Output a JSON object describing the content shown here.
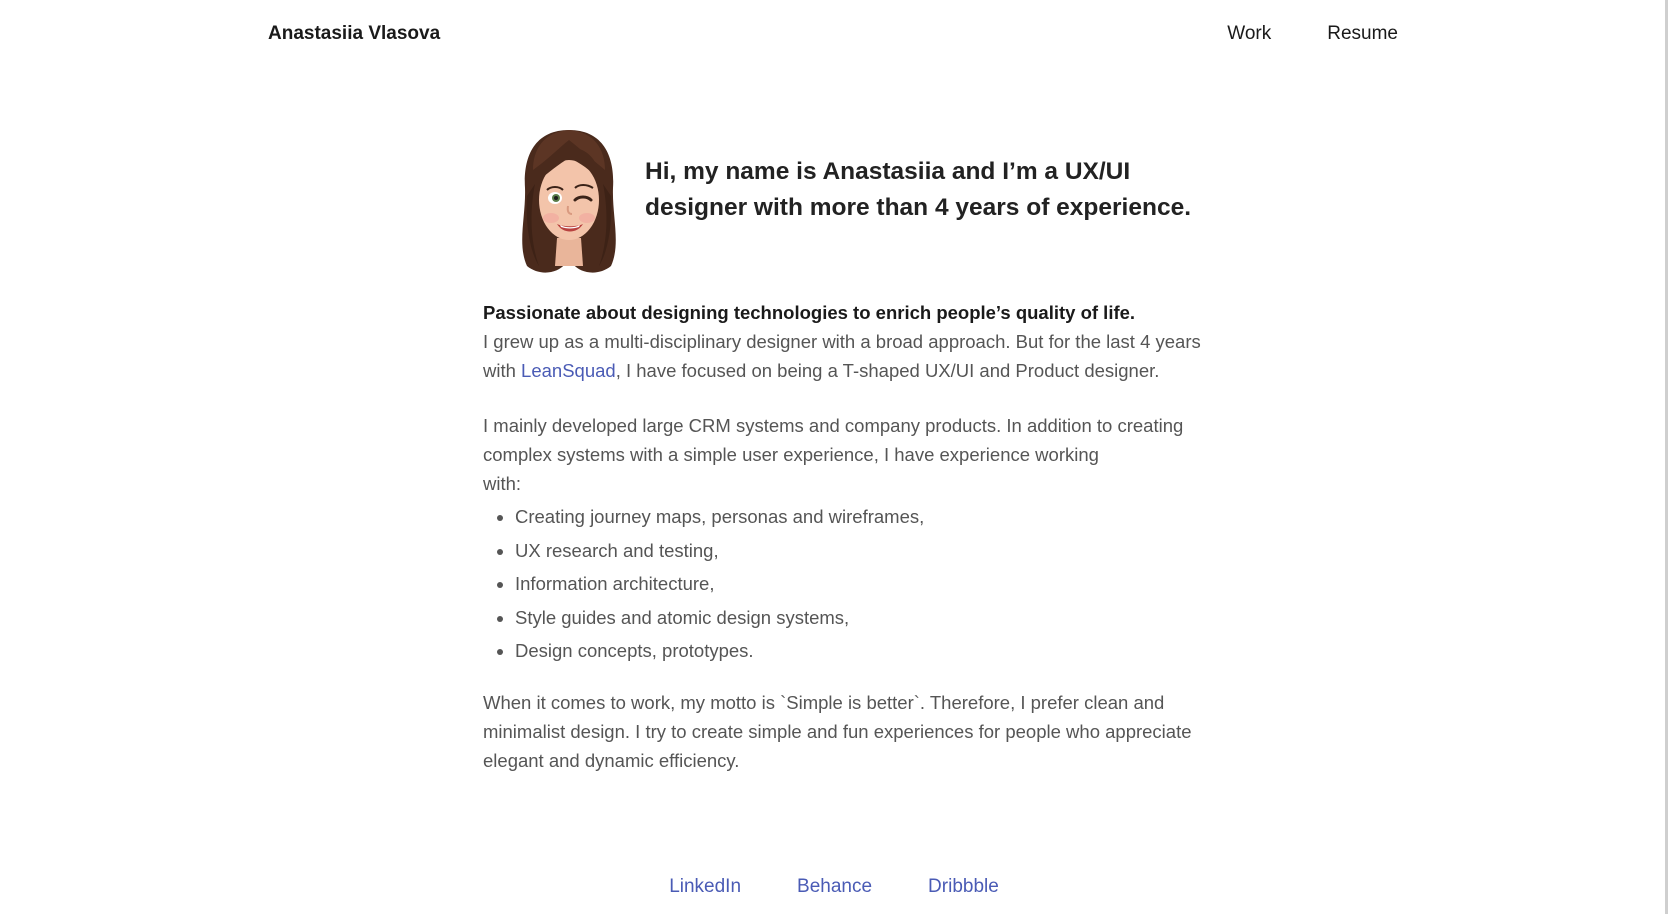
{
  "header": {
    "brand": "Anastasiia Vlasova",
    "nav": [
      {
        "label": "Work"
      },
      {
        "label": "Resume"
      }
    ]
  },
  "intro": {
    "avatar_icon": "memoji-avatar-winking",
    "headline": "Hi, my name is Anastasiia and I’m a UX/UI designer with more than 4 years of experience."
  },
  "about": {
    "lead": "Passionate about designing technologies to enrich people’s quality of life.",
    "p1_before": "I grew up as a multi-disciplinary designer with a broad approach. But for the last 4 years with ",
    "p1_link": "LeanSquad",
    "p1_after": ", I have focused on being a T-shaped UX/UI and Product designer.",
    "p2_line1": "I mainly developed large CRM systems and company products. In addition to creating complex systems with a simple user experience, I have experience working",
    "p2_line2": "with:",
    "skills": [
      "Creating journey maps, personas and wireframes,",
      "UX research and testing,",
      "Information architecture,",
      "Style guides and atomic design systems,",
      "Design concepts, prototypes."
    ],
    "motto": "When it comes to work, my motto is `Simple is better`. Therefore, I prefer clean and minimalist design. I try to create simple and fun experiences for people who appreciate elegant and dynamic efficiency."
  },
  "footer": {
    "links": [
      {
        "label": "LinkedIn"
      },
      {
        "label": "Behance"
      },
      {
        "label": "Dribbble"
      }
    ]
  },
  "colors": {
    "link": "#4a5bb5",
    "text": "#555555",
    "heading": "#222222",
    "background": "#ffffff"
  }
}
